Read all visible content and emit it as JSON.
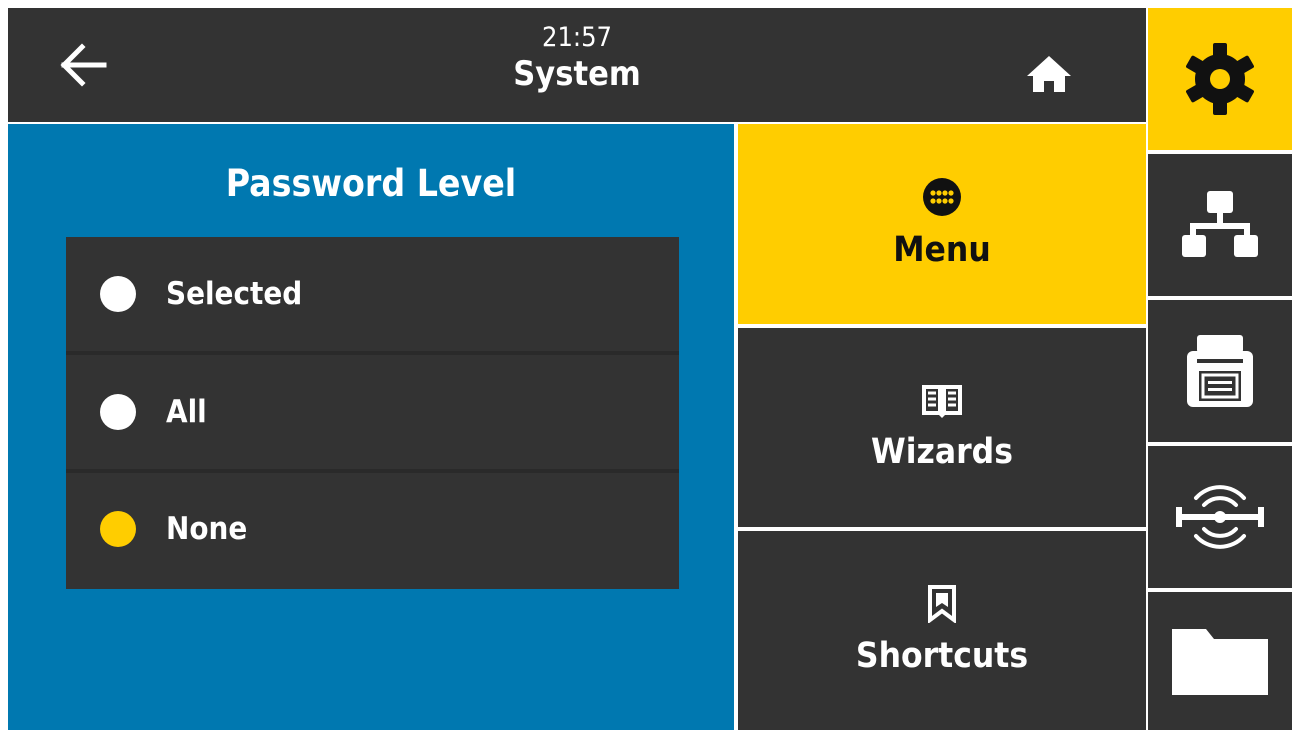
{
  "header": {
    "time": "21:57",
    "title": "System",
    "back_icon": "arrow-left-icon",
    "home_icon": "home-icon"
  },
  "panel": {
    "title": "Password Level",
    "options": [
      {
        "label": "Selected",
        "selected": false
      },
      {
        "label": "All",
        "selected": false
      },
      {
        "label": "None",
        "selected": true
      }
    ]
  },
  "menu": {
    "items": [
      {
        "label": "Menu",
        "icon": "grid-dots-icon",
        "active": true
      },
      {
        "label": "Wizards",
        "icon": "book-icon",
        "active": false
      },
      {
        "label": "Shortcuts",
        "icon": "bookmark-icon",
        "active": false
      }
    ]
  },
  "sidebar": {
    "items": [
      {
        "icon": "gear-icon",
        "active": true
      },
      {
        "icon": "network-icon",
        "active": false
      },
      {
        "icon": "printer-icon",
        "active": false
      },
      {
        "icon": "rfid-icon",
        "active": false
      },
      {
        "icon": "folder-icon",
        "active": false
      }
    ]
  },
  "colors": {
    "accent_yellow": "#ffcd00",
    "content_blue": "#0078b0",
    "dark": "#333333",
    "radio_unselected": "#ffffff",
    "radio_selected": "#ffcd00"
  }
}
